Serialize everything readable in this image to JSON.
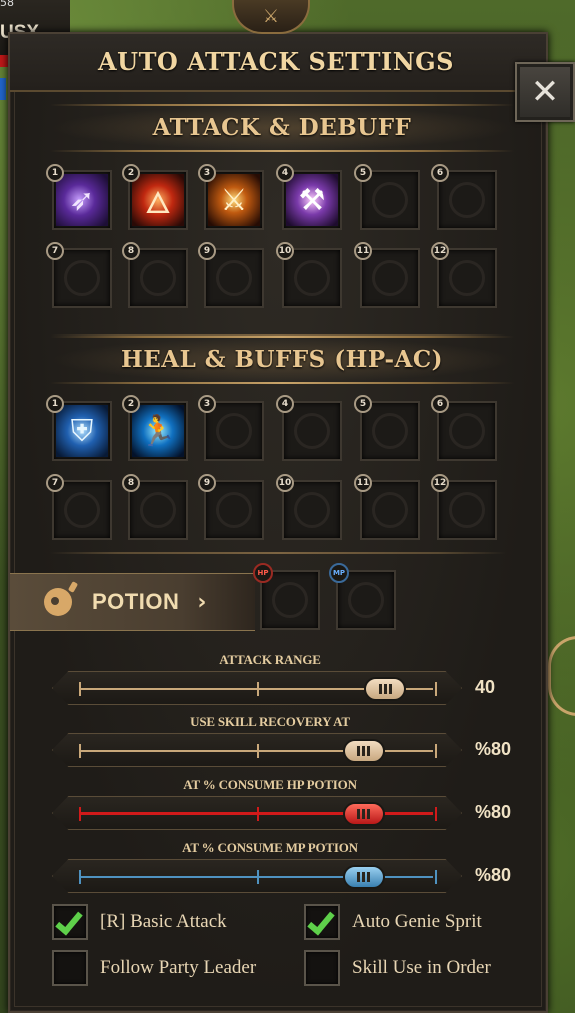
{
  "background": {
    "top_left_number": "58",
    "top_left_name": "USX"
  },
  "dialog": {
    "title": "AUTO ATTACK SETTINGS",
    "close_icon": "close-icon",
    "sections": {
      "attack": {
        "title": "ATTACK & DEBUFF",
        "slots": [
          {
            "n": "1",
            "icon": "spear-strike-icon",
            "glyph": "➶",
            "style": "sk-purple"
          },
          {
            "n": "2",
            "icon": "fire-slash-icon",
            "glyph": "🜂",
            "style": "sk-fire"
          },
          {
            "n": "3",
            "icon": "golden-sword-icon",
            "glyph": "⚔",
            "style": "sk-gold"
          },
          {
            "n": "4",
            "icon": "axe-icon",
            "glyph": "⚒",
            "style": "sk-violet"
          },
          {
            "n": "5"
          },
          {
            "n": "6"
          },
          {
            "n": "7"
          },
          {
            "n": "8"
          },
          {
            "n": "9"
          },
          {
            "n": "10"
          },
          {
            "n": "11"
          },
          {
            "n": "12"
          }
        ]
      },
      "heal": {
        "title": "HEAL & BUFFS (HP-AC)",
        "slots": [
          {
            "n": "1",
            "icon": "shield-buff-icon",
            "glyph": "⛨",
            "style": "sk-blue"
          },
          {
            "n": "2",
            "icon": "dash-buff-icon",
            "glyph": "🏃",
            "style": "sk-cyan"
          },
          {
            "n": "3"
          },
          {
            "n": "4"
          },
          {
            "n": "5"
          },
          {
            "n": "6"
          },
          {
            "n": "7"
          },
          {
            "n": "8"
          },
          {
            "n": "9"
          },
          {
            "n": "10"
          },
          {
            "n": "11"
          },
          {
            "n": "12"
          }
        ]
      }
    },
    "potion": {
      "label": "POTION",
      "chevron": "›",
      "hp_badge": "HP",
      "mp_badge": "MP"
    },
    "sliders": [
      {
        "id": "attack-range",
        "title": "ATTACK RANGE",
        "value": "40",
        "percent": 86,
        "color": "tan"
      },
      {
        "id": "skill-recovery",
        "title": "USE SKILL RECOVERY AT",
        "value": "%80",
        "percent": 80,
        "color": "tan"
      },
      {
        "id": "hp-potion",
        "title": "AT % CONSUME HP POTION",
        "value": "%80",
        "percent": 80,
        "color": "red"
      },
      {
        "id": "mp-potion",
        "title": "AT % CONSUME MP POTION",
        "value": "%80",
        "percent": 80,
        "color": "blue"
      }
    ],
    "checkboxes": [
      {
        "id": "basic-attack",
        "label": "[R] Basic Attack",
        "checked": true
      },
      {
        "id": "auto-genie",
        "label": "Auto Genie Sprit",
        "checked": true
      },
      {
        "id": "follow-party",
        "label": "Follow Party Leader",
        "checked": false
      },
      {
        "id": "skill-order",
        "label": "Skill Use in Order",
        "checked": false
      }
    ]
  }
}
